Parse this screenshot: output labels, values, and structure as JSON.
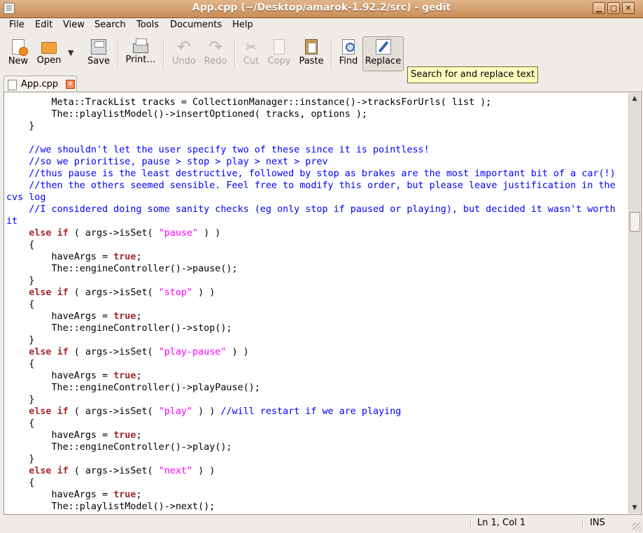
{
  "window": {
    "title": "App.cpp (~/Desktop/amarok-1.92.2/src) - gedit"
  },
  "menu": [
    {
      "label": "File"
    },
    {
      "label": "Edit"
    },
    {
      "label": "View"
    },
    {
      "label": "Search"
    },
    {
      "label": "Tools"
    },
    {
      "label": "Documents"
    },
    {
      "label": "Help"
    }
  ],
  "toolbar": {
    "new": "New",
    "open": "Open",
    "save": "Save",
    "print": "Print…",
    "undo": "Undo",
    "redo": "Redo",
    "cut": "Cut",
    "copy": "Copy",
    "paste": "Paste",
    "find": "Find",
    "replace": "Replace"
  },
  "tooltip": "Search for and replace text",
  "tab": {
    "name": "App.cpp"
  },
  "status": {
    "position": "Ln 1, Col 1",
    "mode": "INS"
  }
}
